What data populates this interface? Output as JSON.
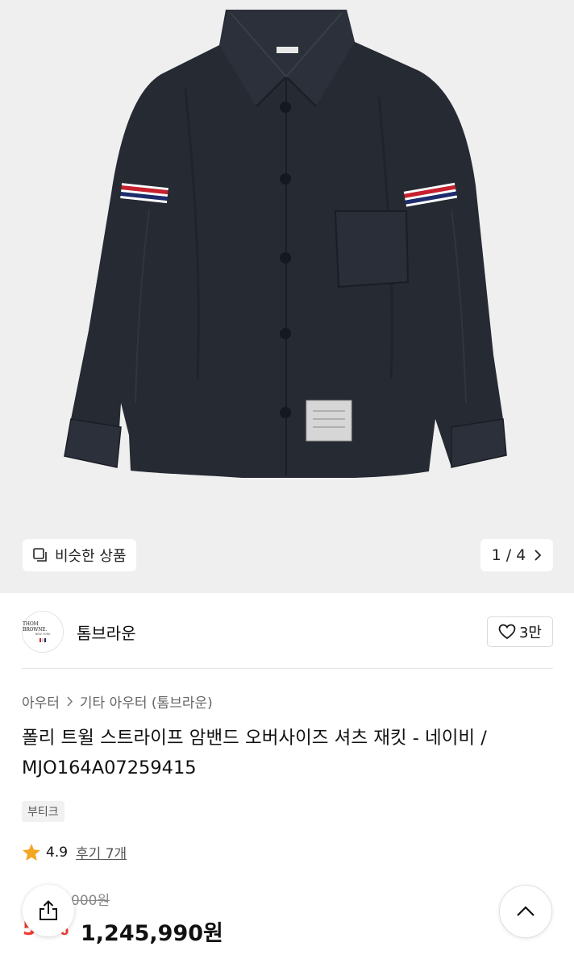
{
  "product_image": {
    "alt_icon": "navy-shirt-jacket-image"
  },
  "gallery": {
    "similar_label": "비슷한 상품",
    "current_page": "1",
    "separator": "/",
    "total_pages": "4"
  },
  "brand": {
    "logo_text": "THOM BROWNE.",
    "logo_subtext": "NEW YORK",
    "name": "톰브라운",
    "like_count": "3만"
  },
  "breadcrumb": {
    "items": [
      "아우터",
      "기타 아우터 (톰브라운)"
    ]
  },
  "product": {
    "title": "폴리 트윌 스트라이프 암밴드 오버사이즈 셔츠 재킷 - 네이비 / MJO164A07259415",
    "tag": "부티크",
    "rating": "4.9",
    "reviews": "후기 7개",
    "original_price": "000원",
    "discount": "50%",
    "price": "1,245,990원"
  },
  "colors": {
    "accent_red": "#f03b2e",
    "star": "#f5a623",
    "jacket": "#262a33",
    "stripe_red": "#c8202e",
    "stripe_blue": "#1d2c6e"
  }
}
